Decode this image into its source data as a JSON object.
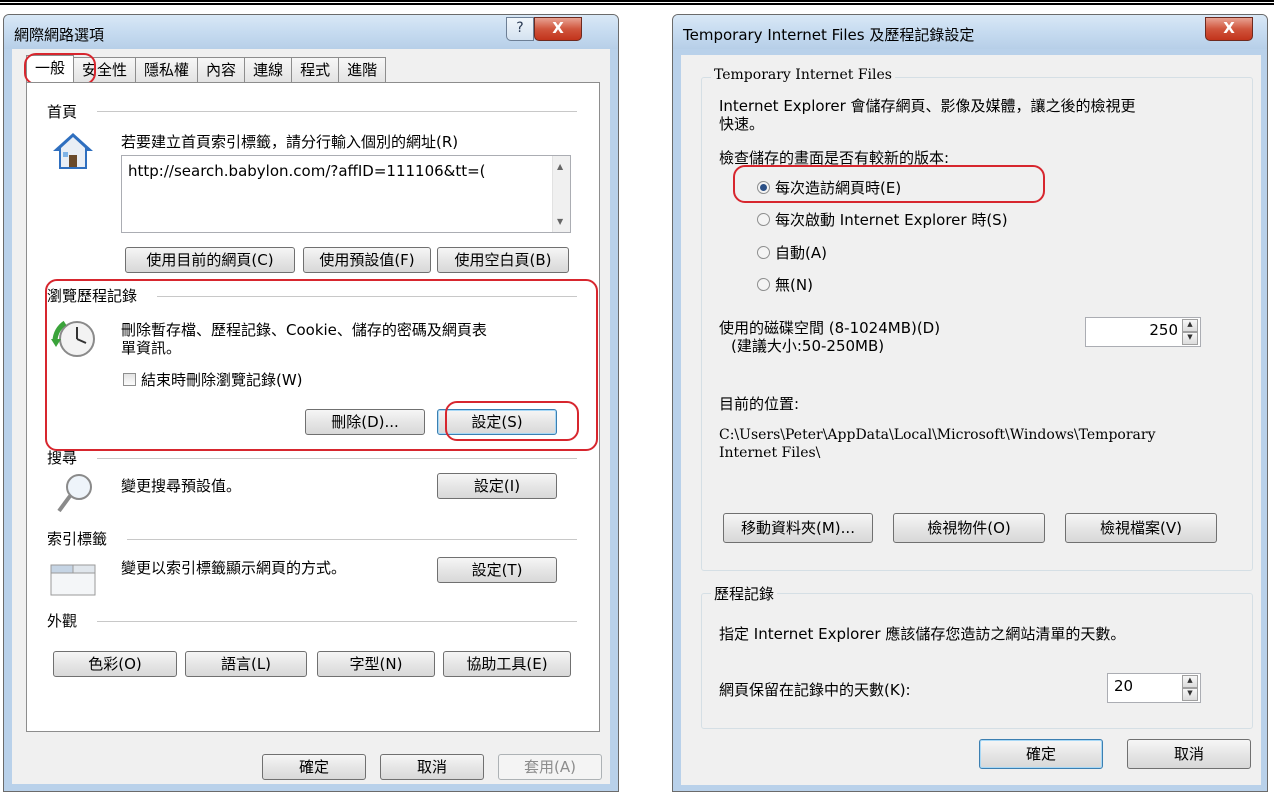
{
  "left_dialog": {
    "title": "網際網路選項",
    "help_icon": "?",
    "close_icon": "X",
    "tabs": [
      "一般",
      "安全性",
      "隱私權",
      "內容",
      "連線",
      "程式",
      "進階"
    ],
    "home": {
      "section": "首頁",
      "instruction": "若要建立首頁索引標籤，請分行輸入個別的網址(R)",
      "url": "http://search.babylon.com/?affID=111106&tt=(",
      "buttons": [
        "使用目前的網頁(C)",
        "使用預設值(F)",
        "使用空白頁(B)"
      ]
    },
    "history": {
      "section": "瀏覽歷程記錄",
      "desc_line1": "刪除暫存檔、歷程記錄、Cookie、儲存的密碼及網頁表",
      "desc_line2": "單資訊。",
      "checkbox_label": "結束時刪除瀏覽記錄(W)",
      "delete_button": "刪除(D)...",
      "settings_button": "設定(S)"
    },
    "search": {
      "section": "搜尋",
      "desc": "變更搜尋預設值。",
      "settings_button": "設定(I)"
    },
    "tabs_section": {
      "section": "索引標籤",
      "desc": "變更以索引標籤顯示網頁的方式。",
      "settings_button": "設定(T)"
    },
    "appearance": {
      "section": "外觀",
      "buttons": [
        "色彩(O)",
        "語言(L)",
        "字型(N)",
        "協助工具(E)"
      ]
    },
    "footer": {
      "ok": "確定",
      "cancel": "取消",
      "apply": "套用(A)"
    }
  },
  "right_dialog": {
    "title": "Temporary Internet Files 及歷程記錄設定",
    "close_icon": "X",
    "tif_group": {
      "label": "Temporary Internet Files",
      "desc_line1": "Internet Explorer 會儲存網頁、影像及媒體，讓之後的檢視更",
      "desc_line2": "快速。",
      "check_label": "檢查儲存的畫面是否有較新的版本:",
      "options": [
        "每次造訪網頁時(E)",
        "每次啟動 Internet Explorer 時(S)",
        "自動(A)",
        "無(N)"
      ],
      "selected_option": "每次造訪網頁時(E)",
      "disk_label_line1": "使用的磁碟空間 (8-1024MB)(D)",
      "disk_label_line2": "(建議大小:50-250MB)",
      "disk_value": "250",
      "location_label": "目前的位置:",
      "location_line1": "C:\\Users\\Peter\\AppData\\Local\\Microsoft\\Windows\\Temporary",
      "location_line2": "Internet Files\\",
      "buttons": [
        "移動資料夾(M)...",
        "檢視物件(O)",
        "檢視檔案(V)"
      ]
    },
    "history_group": {
      "label": "歷程記錄",
      "desc": "指定 Internet Explorer 應該儲存您造訪之網站清單的天數。",
      "days_label": "網頁保留在記錄中的天數(K):",
      "days_value": "20"
    },
    "footer": {
      "ok": "確定",
      "cancel": "取消"
    }
  },
  "colors": {
    "highlight": "#d7262e",
    "title_bg": "#c6dbf0",
    "panel_bg": "#f0f0f0"
  }
}
